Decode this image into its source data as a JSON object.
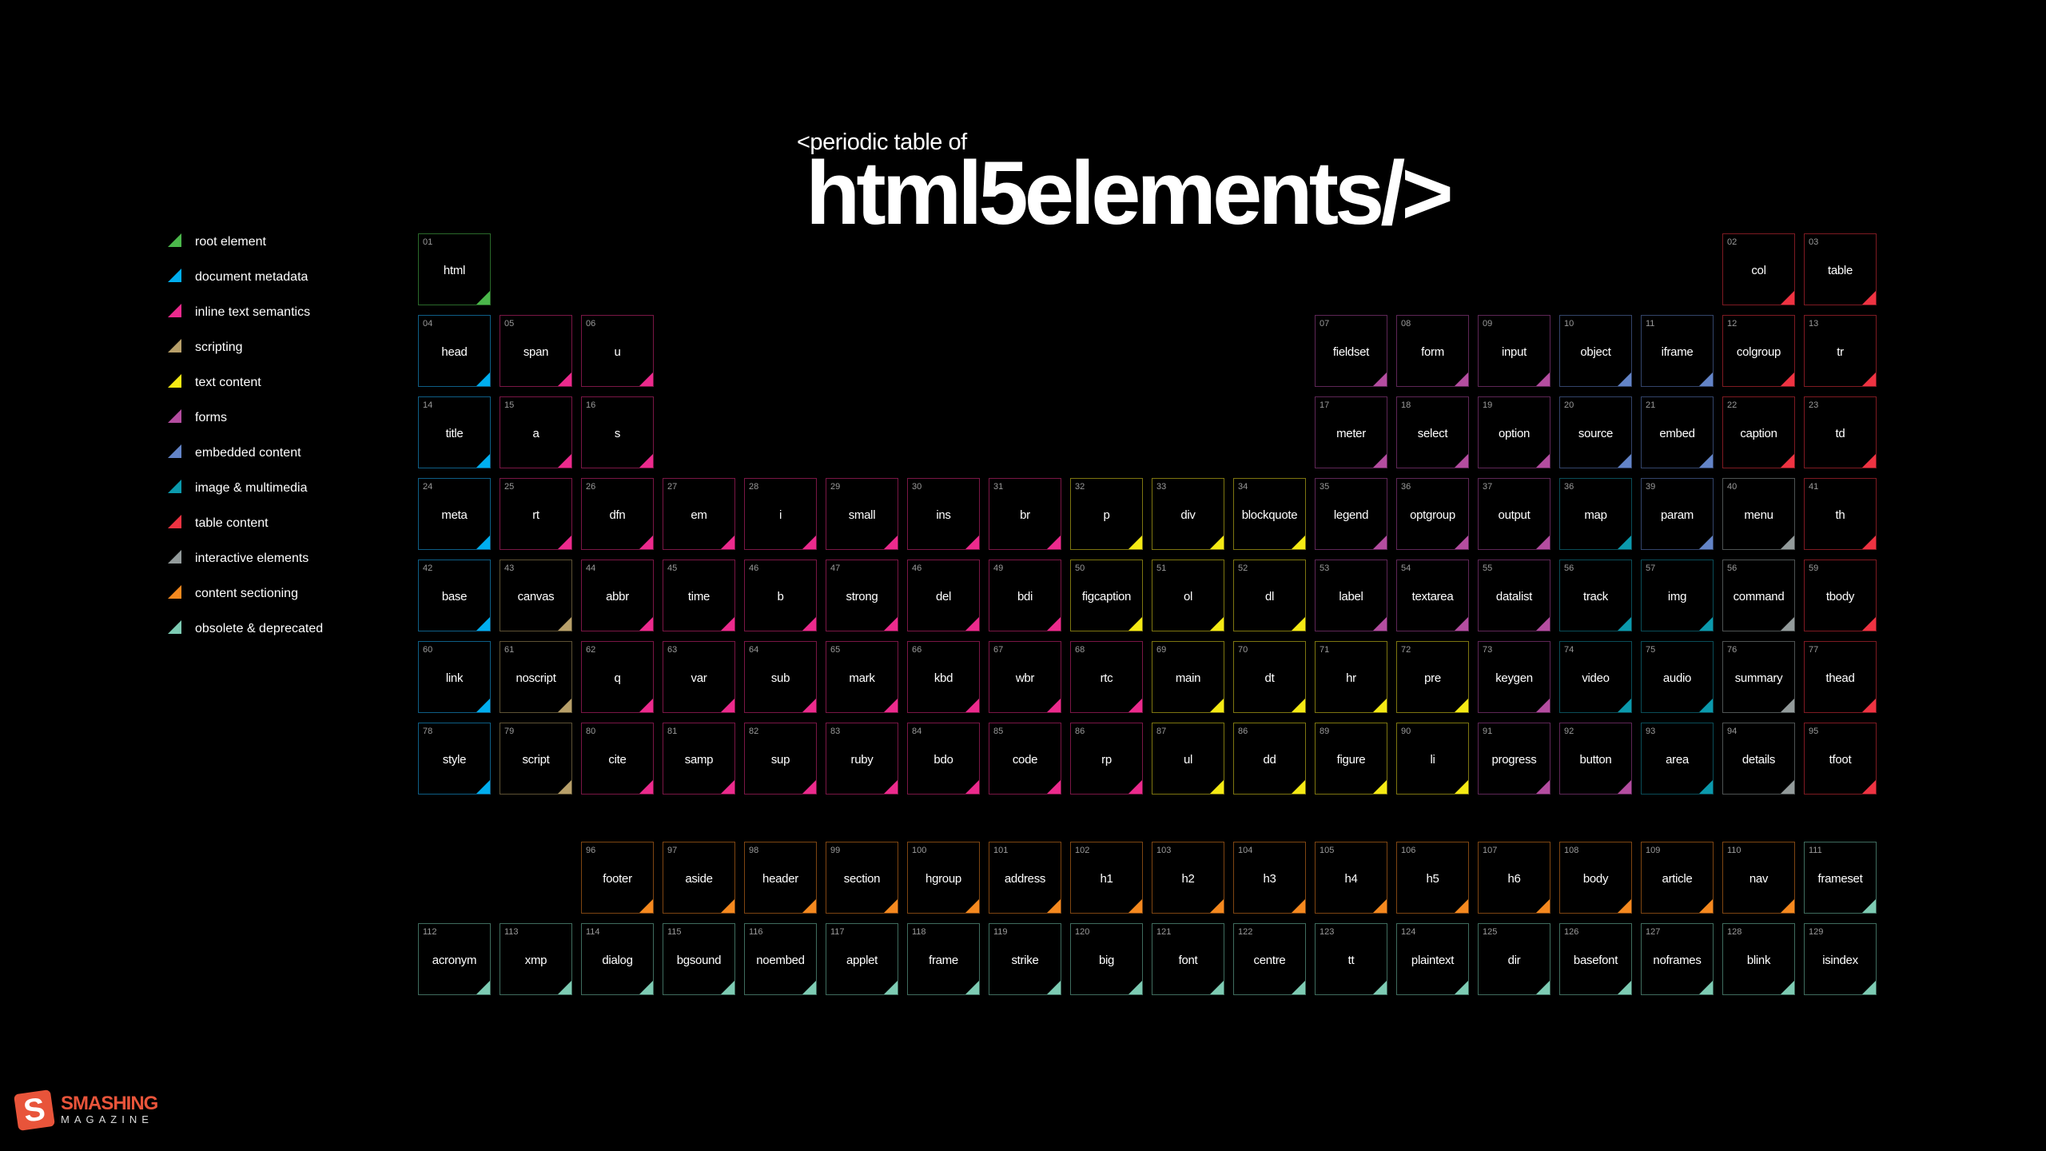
{
  "header": {
    "subtitle": "<periodic table of",
    "title": "html5elements/>"
  },
  "categories": {
    "root": {
      "label": "root element",
      "color": "#4bb74b",
      "border": "#2a6a2a"
    },
    "meta": {
      "label": "document metadata",
      "color": "#00aeef",
      "border": "#0e5e86"
    },
    "inline": {
      "label": "inline text semantics",
      "color": "#ec2a8d",
      "border": "#7a1645"
    },
    "scripting": {
      "label": "scripting",
      "color": "#b8a06a",
      "border": "#5e5234"
    },
    "text": {
      "label": "text content",
      "color": "#f5ea14",
      "border": "#7d7510"
    },
    "forms": {
      "label": "forms",
      "color": "#b44da0",
      "border": "#5e2656"
    },
    "embedded": {
      "label": "embedded content",
      "color": "#6384c7",
      "border": "#33446a"
    },
    "media": {
      "label": "image & multimedia",
      "color": "#0b9aad",
      "border": "#0a4d58"
    },
    "table": {
      "label": "table content",
      "color": "#ef3342",
      "border": "#7e1a22"
    },
    "interactive": {
      "label": "interactive elements",
      "color": "#939b9b",
      "border": "#4e5353"
    },
    "sectioning": {
      "label": "content sectioning",
      "color": "#f5891f",
      "border": "#7e4512"
    },
    "obsolete": {
      "label": "obsolete & deprecated",
      "color": "#7dcbb3",
      "border": "#3f6c5e"
    }
  },
  "legend_order": [
    "root",
    "meta",
    "inline",
    "scripting",
    "text",
    "forms",
    "embedded",
    "media",
    "table",
    "interactive",
    "sectioning",
    "obsolete"
  ],
  "elements": [
    {
      "num": "01",
      "name": "html",
      "cat": "root",
      "row": 0,
      "col": 0
    },
    {
      "num": "02",
      "name": "col",
      "cat": "table",
      "row": 0,
      "col": 16
    },
    {
      "num": "03",
      "name": "table",
      "cat": "table",
      "row": 0,
      "col": 17
    },
    {
      "num": "04",
      "name": "head",
      "cat": "meta",
      "row": 1,
      "col": 0
    },
    {
      "num": "05",
      "name": "span",
      "cat": "inline",
      "row": 1,
      "col": 1
    },
    {
      "num": "06",
      "name": "u",
      "cat": "inline",
      "row": 1,
      "col": 2
    },
    {
      "num": "07",
      "name": "fieldset",
      "cat": "forms",
      "row": 1,
      "col": 11
    },
    {
      "num": "08",
      "name": "form",
      "cat": "forms",
      "row": 1,
      "col": 12
    },
    {
      "num": "09",
      "name": "input",
      "cat": "forms",
      "row": 1,
      "col": 13
    },
    {
      "num": "10",
      "name": "object",
      "cat": "embedded",
      "row": 1,
      "col": 14
    },
    {
      "num": "11",
      "name": "iframe",
      "cat": "embedded",
      "row": 1,
      "col": 15
    },
    {
      "num": "12",
      "name": "colgroup",
      "cat": "table",
      "row": 1,
      "col": 16
    },
    {
      "num": "13",
      "name": "tr",
      "cat": "table",
      "row": 1,
      "col": 17
    },
    {
      "num": "14",
      "name": "title",
      "cat": "meta",
      "row": 2,
      "col": 0
    },
    {
      "num": "15",
      "name": "a",
      "cat": "inline",
      "row": 2,
      "col": 1
    },
    {
      "num": "16",
      "name": "s",
      "cat": "inline",
      "row": 2,
      "col": 2
    },
    {
      "num": "17",
      "name": "meter",
      "cat": "forms",
      "row": 2,
      "col": 11
    },
    {
      "num": "18",
      "name": "select",
      "cat": "forms",
      "row": 2,
      "col": 12
    },
    {
      "num": "19",
      "name": "option",
      "cat": "forms",
      "row": 2,
      "col": 13
    },
    {
      "num": "20",
      "name": "source",
      "cat": "embedded",
      "row": 2,
      "col": 14
    },
    {
      "num": "21",
      "name": "embed",
      "cat": "embedded",
      "row": 2,
      "col": 15
    },
    {
      "num": "22",
      "name": "caption",
      "cat": "table",
      "row": 2,
      "col": 16
    },
    {
      "num": "23",
      "name": "td",
      "cat": "table",
      "row": 2,
      "col": 17
    },
    {
      "num": "24",
      "name": "meta",
      "cat": "meta",
      "row": 3,
      "col": 0
    },
    {
      "num": "25",
      "name": "rt",
      "cat": "inline",
      "row": 3,
      "col": 1
    },
    {
      "num": "26",
      "name": "dfn",
      "cat": "inline",
      "row": 3,
      "col": 2
    },
    {
      "num": "27",
      "name": "em",
      "cat": "inline",
      "row": 3,
      "col": 3
    },
    {
      "num": "28",
      "name": "i",
      "cat": "inline",
      "row": 3,
      "col": 4
    },
    {
      "num": "29",
      "name": "small",
      "cat": "inline",
      "row": 3,
      "col": 5
    },
    {
      "num": "30",
      "name": "ins",
      "cat": "inline",
      "row": 3,
      "col": 6
    },
    {
      "num": "31",
      "name": "br",
      "cat": "inline",
      "row": 3,
      "col": 7
    },
    {
      "num": "32",
      "name": "p",
      "cat": "text",
      "row": 3,
      "col": 8
    },
    {
      "num": "33",
      "name": "div",
      "cat": "text",
      "row": 3,
      "col": 9
    },
    {
      "num": "34",
      "name": "blockquote",
      "cat": "text",
      "row": 3,
      "col": 10
    },
    {
      "num": "35",
      "name": "legend",
      "cat": "forms",
      "row": 3,
      "col": 11
    },
    {
      "num": "36",
      "name": "optgroup",
      "cat": "forms",
      "row": 3,
      "col": 12
    },
    {
      "num": "37",
      "name": "output",
      "cat": "forms",
      "row": 3,
      "col": 13
    },
    {
      "num": "36",
      "name": "map",
      "cat": "media",
      "row": 3,
      "col": 14
    },
    {
      "num": "39",
      "name": "param",
      "cat": "embedded",
      "row": 3,
      "col": 15
    },
    {
      "num": "40",
      "name": "menu",
      "cat": "interactive",
      "row": 3,
      "col": 16
    },
    {
      "num": "41",
      "name": "th",
      "cat": "table",
      "row": 3,
      "col": 17
    },
    {
      "num": "42",
      "name": "base",
      "cat": "meta",
      "row": 4,
      "col": 0
    },
    {
      "num": "43",
      "name": "canvas",
      "cat": "scripting",
      "row": 4,
      "col": 1
    },
    {
      "num": "44",
      "name": "abbr",
      "cat": "inline",
      "row": 4,
      "col": 2
    },
    {
      "num": "45",
      "name": "time",
      "cat": "inline",
      "row": 4,
      "col": 3
    },
    {
      "num": "46",
      "name": "b",
      "cat": "inline",
      "row": 4,
      "col": 4
    },
    {
      "num": "47",
      "name": "strong",
      "cat": "inline",
      "row": 4,
      "col": 5
    },
    {
      "num": "46",
      "name": "del",
      "cat": "inline",
      "row": 4,
      "col": 6
    },
    {
      "num": "49",
      "name": "bdi",
      "cat": "inline",
      "row": 4,
      "col": 7
    },
    {
      "num": "50",
      "name": "figcaption",
      "cat": "text",
      "row": 4,
      "col": 8
    },
    {
      "num": "51",
      "name": "ol",
      "cat": "text",
      "row": 4,
      "col": 9
    },
    {
      "num": "52",
      "name": "dl",
      "cat": "text",
      "row": 4,
      "col": 10
    },
    {
      "num": "53",
      "name": "label",
      "cat": "forms",
      "row": 4,
      "col": 11
    },
    {
      "num": "54",
      "name": "textarea",
      "cat": "forms",
      "row": 4,
      "col": 12
    },
    {
      "num": "55",
      "name": "datalist",
      "cat": "forms",
      "row": 4,
      "col": 13
    },
    {
      "num": "56",
      "name": "track",
      "cat": "media",
      "row": 4,
      "col": 14
    },
    {
      "num": "57",
      "name": "img",
      "cat": "media",
      "row": 4,
      "col": 15
    },
    {
      "num": "56",
      "name": "command",
      "cat": "interactive",
      "row": 4,
      "col": 16
    },
    {
      "num": "59",
      "name": "tbody",
      "cat": "table",
      "row": 4,
      "col": 17
    },
    {
      "num": "60",
      "name": "link",
      "cat": "meta",
      "row": 5,
      "col": 0
    },
    {
      "num": "61",
      "name": "noscript",
      "cat": "scripting",
      "row": 5,
      "col": 1
    },
    {
      "num": "62",
      "name": "q",
      "cat": "inline",
      "row": 5,
      "col": 2
    },
    {
      "num": "63",
      "name": "var",
      "cat": "inline",
      "row": 5,
      "col": 3
    },
    {
      "num": "64",
      "name": "sub",
      "cat": "inline",
      "row": 5,
      "col": 4
    },
    {
      "num": "65",
      "name": "mark",
      "cat": "inline",
      "row": 5,
      "col": 5
    },
    {
      "num": "66",
      "name": "kbd",
      "cat": "inline",
      "row": 5,
      "col": 6
    },
    {
      "num": "67",
      "name": "wbr",
      "cat": "inline",
      "row": 5,
      "col": 7
    },
    {
      "num": "68",
      "name": "rtc",
      "cat": "inline",
      "row": 5,
      "col": 8
    },
    {
      "num": "69",
      "name": "main",
      "cat": "text",
      "row": 5,
      "col": 9
    },
    {
      "num": "70",
      "name": "dt",
      "cat": "text",
      "row": 5,
      "col": 10
    },
    {
      "num": "71",
      "name": "hr",
      "cat": "text",
      "row": 5,
      "col": 11
    },
    {
      "num": "72",
      "name": "pre",
      "cat": "text",
      "row": 5,
      "col": 12
    },
    {
      "num": "73",
      "name": "keygen",
      "cat": "forms",
      "row": 5,
      "col": 13
    },
    {
      "num": "74",
      "name": "video",
      "cat": "media",
      "row": 5,
      "col": 14
    },
    {
      "num": "75",
      "name": "audio",
      "cat": "media",
      "row": 5,
      "col": 15
    },
    {
      "num": "76",
      "name": "summary",
      "cat": "interactive",
      "row": 5,
      "col": 16
    },
    {
      "num": "77",
      "name": "thead",
      "cat": "table",
      "row": 5,
      "col": 17
    },
    {
      "num": "78",
      "name": "style",
      "cat": "meta",
      "row": 6,
      "col": 0
    },
    {
      "num": "79",
      "name": "script",
      "cat": "scripting",
      "row": 6,
      "col": 1
    },
    {
      "num": "80",
      "name": "cite",
      "cat": "inline",
      "row": 6,
      "col": 2
    },
    {
      "num": "81",
      "name": "samp",
      "cat": "inline",
      "row": 6,
      "col": 3
    },
    {
      "num": "82",
      "name": "sup",
      "cat": "inline",
      "row": 6,
      "col": 4
    },
    {
      "num": "83",
      "name": "ruby",
      "cat": "inline",
      "row": 6,
      "col": 5
    },
    {
      "num": "84",
      "name": "bdo",
      "cat": "inline",
      "row": 6,
      "col": 6
    },
    {
      "num": "85",
      "name": "code",
      "cat": "inline",
      "row": 6,
      "col": 7
    },
    {
      "num": "86",
      "name": "rp",
      "cat": "inline",
      "row": 6,
      "col": 8
    },
    {
      "num": "87",
      "name": "ul",
      "cat": "text",
      "row": 6,
      "col": 9
    },
    {
      "num": "86",
      "name": "dd",
      "cat": "text",
      "row": 6,
      "col": 10
    },
    {
      "num": "89",
      "name": "figure",
      "cat": "text",
      "row": 6,
      "col": 11
    },
    {
      "num": "90",
      "name": "li",
      "cat": "text",
      "row": 6,
      "col": 12
    },
    {
      "num": "91",
      "name": "progress",
      "cat": "forms",
      "row": 6,
      "col": 13
    },
    {
      "num": "92",
      "name": "button",
      "cat": "forms",
      "row": 6,
      "col": 14
    },
    {
      "num": "93",
      "name": "area",
      "cat": "media",
      "row": 6,
      "col": 15
    },
    {
      "num": "94",
      "name": "details",
      "cat": "interactive",
      "row": 6,
      "col": 16
    },
    {
      "num": "95",
      "name": "tfoot",
      "cat": "table",
      "row": 6,
      "col": 17
    },
    {
      "num": "96",
      "name": "footer",
      "cat": "sectioning",
      "row": 7,
      "col": 2
    },
    {
      "num": "97",
      "name": "aside",
      "cat": "sectioning",
      "row": 7,
      "col": 3
    },
    {
      "num": "98",
      "name": "header",
      "cat": "sectioning",
      "row": 7,
      "col": 4
    },
    {
      "num": "99",
      "name": "section",
      "cat": "sectioning",
      "row": 7,
      "col": 5
    },
    {
      "num": "100",
      "name": "hgroup",
      "cat": "sectioning",
      "row": 7,
      "col": 6
    },
    {
      "num": "101",
      "name": "address",
      "cat": "sectioning",
      "row": 7,
      "col": 7
    },
    {
      "num": "102",
      "name": "h1",
      "cat": "sectioning",
      "row": 7,
      "col": 8
    },
    {
      "num": "103",
      "name": "h2",
      "cat": "sectioning",
      "row": 7,
      "col": 9
    },
    {
      "num": "104",
      "name": "h3",
      "cat": "sectioning",
      "row": 7,
      "col": 10
    },
    {
      "num": "105",
      "name": "h4",
      "cat": "sectioning",
      "row": 7,
      "col": 11
    },
    {
      "num": "106",
      "name": "h5",
      "cat": "sectioning",
      "row": 7,
      "col": 12
    },
    {
      "num": "107",
      "name": "h6",
      "cat": "sectioning",
      "row": 7,
      "col": 13
    },
    {
      "num": "108",
      "name": "body",
      "cat": "sectioning",
      "row": 7,
      "col": 14
    },
    {
      "num": "109",
      "name": "article",
      "cat": "sectioning",
      "row": 7,
      "col": 15
    },
    {
      "num": "110",
      "name": "nav",
      "cat": "sectioning",
      "row": 7,
      "col": 16
    },
    {
      "num": "111",
      "name": "frameset",
      "cat": "obsolete",
      "row": 7,
      "col": 17
    },
    {
      "num": "112",
      "name": "acronym",
      "cat": "obsolete",
      "row": 8,
      "col": 0
    },
    {
      "num": "113",
      "name": "xmp",
      "cat": "obsolete",
      "row": 8,
      "col": 1
    },
    {
      "num": "114",
      "name": "dialog",
      "cat": "obsolete",
      "row": 8,
      "col": 2
    },
    {
      "num": "115",
      "name": "bgsound",
      "cat": "obsolete",
      "row": 8,
      "col": 3
    },
    {
      "num": "116",
      "name": "noembed",
      "cat": "obsolete",
      "row": 8,
      "col": 4
    },
    {
      "num": "117",
      "name": "applet",
      "cat": "obsolete",
      "row": 8,
      "col": 5
    },
    {
      "num": "118",
      "name": "frame",
      "cat": "obsolete",
      "row": 8,
      "col": 6
    },
    {
      "num": "119",
      "name": "strike",
      "cat": "obsolete",
      "row": 8,
      "col": 7
    },
    {
      "num": "120",
      "name": "big",
      "cat": "obsolete",
      "row": 8,
      "col": 8
    },
    {
      "num": "121",
      "name": "font",
      "cat": "obsolete",
      "row": 8,
      "col": 9
    },
    {
      "num": "122",
      "name": "centre",
      "cat": "obsolete",
      "row": 8,
      "col": 10
    },
    {
      "num": "123",
      "name": "tt",
      "cat": "obsolete",
      "row": 8,
      "col": 11
    },
    {
      "num": "124",
      "name": "plaintext",
      "cat": "obsolete",
      "row": 8,
      "col": 12
    },
    {
      "num": "125",
      "name": "dir",
      "cat": "obsolete",
      "row": 8,
      "col": 13
    },
    {
      "num": "126",
      "name": "basefont",
      "cat": "obsolete",
      "row": 8,
      "col": 14
    },
    {
      "num": "127",
      "name": "noframes",
      "cat": "obsolete",
      "row": 8,
      "col": 15
    },
    {
      "num": "128",
      "name": "blink",
      "cat": "obsolete",
      "row": 8,
      "col": 16
    },
    {
      "num": "129",
      "name": "isindex",
      "cat": "obsolete",
      "row": 8,
      "col": 17
    }
  ],
  "logo": {
    "mark": "S",
    "top": "SMASHING",
    "bottom": "MAGAZINE",
    "color": "#e8543a"
  }
}
